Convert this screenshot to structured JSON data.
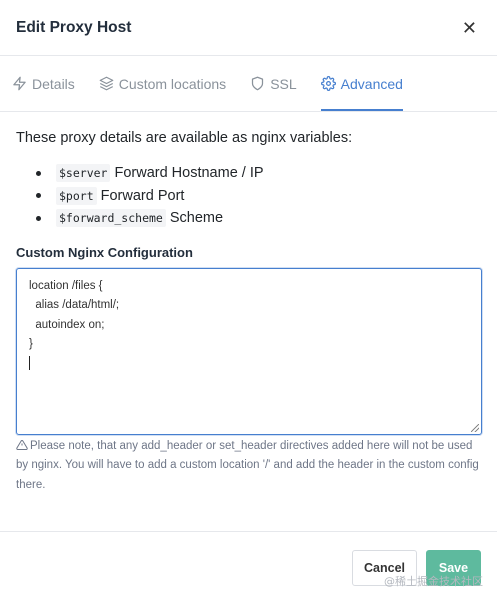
{
  "modal": {
    "title": "Edit Proxy Host",
    "close_glyph": "✕"
  },
  "tabs": [
    {
      "label": "Details",
      "icon": "lightning-icon",
      "active": false
    },
    {
      "label": "Custom locations",
      "icon": "layers-icon",
      "active": false
    },
    {
      "label": "SSL",
      "icon": "shield-icon",
      "active": false
    },
    {
      "label": "Advanced",
      "icon": "gear-icon",
      "active": true
    }
  ],
  "advanced": {
    "intro": "These proxy details are available as nginx variables:",
    "variables": [
      {
        "code": "$server",
        "description": "Forward Hostname / IP"
      },
      {
        "code": "$port",
        "description": "Forward Port"
      },
      {
        "code": "$forward_scheme",
        "description": "Scheme"
      }
    ],
    "config_label": "Custom Nginx Configuration",
    "config_value": "location /files {\n  alias /data/html/;\n  autoindex on;\n}\n",
    "note": "Please note, that any add_header or set_header directives added here will not be used by nginx. You will have to add a custom location '/' and add the header in the custom config there."
  },
  "footer": {
    "cancel_label": "Cancel",
    "save_label": "Save"
  },
  "watermark": "@稀土掘金技术社区",
  "colors": {
    "accent": "#467fcf",
    "save": "#5eba9e",
    "muted": "#8a929b"
  }
}
